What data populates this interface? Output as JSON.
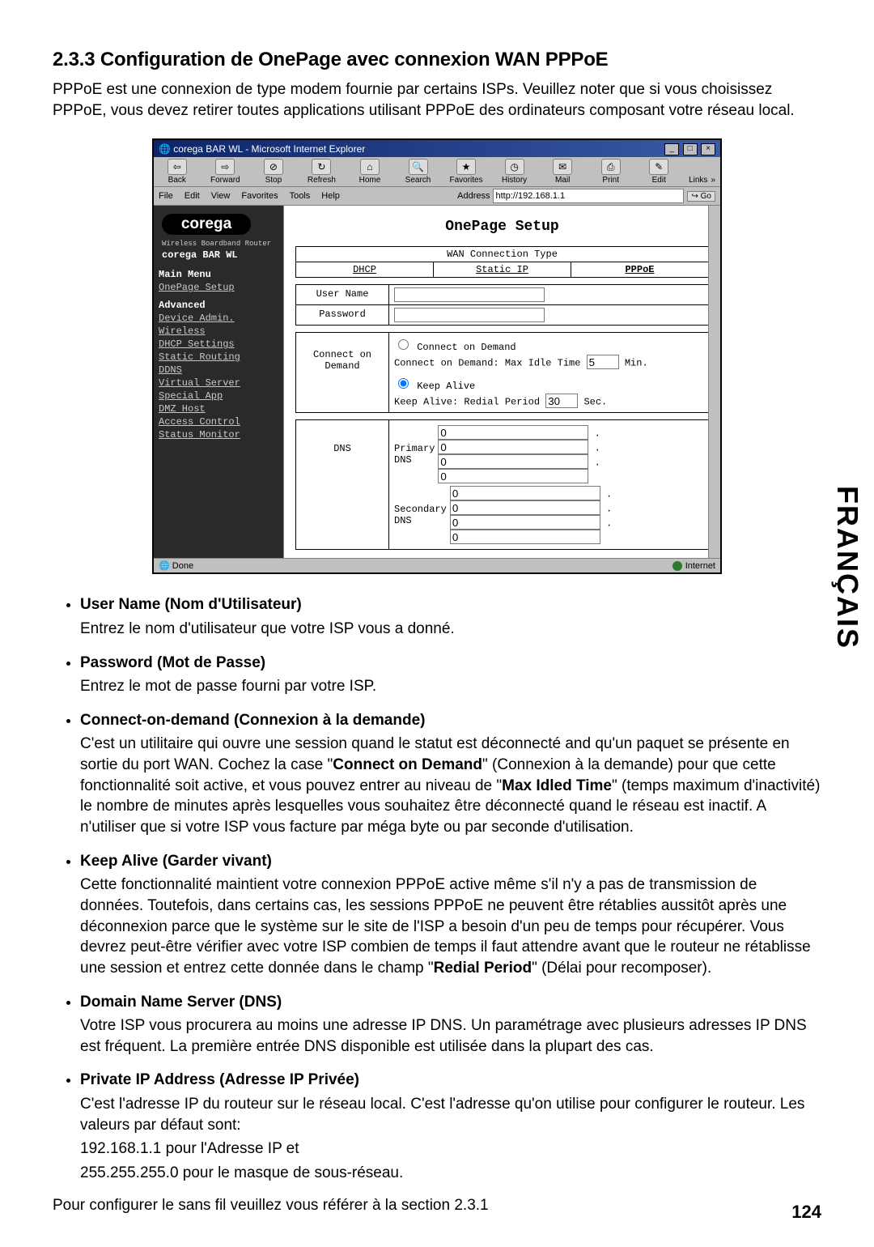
{
  "section_title": "2.3.3 Configuration de OnePage avec connexion WAN PPPoE",
  "intro": "PPPoE  est une connexion de type modem fournie par certains ISPs. Veuillez noter que si vous choisissez PPPoE, vous devez retirer toutes applications utilisant PPPoE des ordinateurs composant votre réseau local.",
  "screenshot": {
    "window_title": "corega BAR WL - Microsoft Internet Explorer",
    "toolbar": {
      "back": "Back",
      "forward": "Forward",
      "stop": "Stop",
      "refresh": "Refresh",
      "home": "Home",
      "search": "Search",
      "favorites": "Favorites",
      "history": "History",
      "mail": "Mail",
      "print": "Print",
      "edit": "Edit"
    },
    "links_label": "Links",
    "menubar": [
      "File",
      "Edit",
      "View",
      "Favorites",
      "Tools",
      "Help"
    ],
    "address_label": "Address",
    "address_value": "http://192.168.1.1",
    "go_label": "Go",
    "sidebar": {
      "logo": "corega",
      "subtitle": "Wireless Boardband Router",
      "product": "corega BAR WL",
      "main_menu_head": "Main Menu",
      "main_menu": [
        "OnePage Setup"
      ],
      "advanced_head": "Advanced",
      "advanced": [
        "Device Admin.",
        "Wireless",
        "DHCP Settings",
        "Static Routing",
        "DDNS",
        "Virtual Server",
        "Special App",
        "DMZ Host",
        "Access Control",
        "Status Monitor"
      ]
    },
    "main": {
      "title": "OnePage Setup",
      "wan_header": "WAN Connection Type",
      "tabs": [
        "DHCP",
        "Static IP",
        "PPPoE"
      ],
      "username_label": "User Name",
      "password_label": "Password",
      "cod_label": "Connect on Demand",
      "cod_radio": "Connect on Demand",
      "cod_line": "Connect on Demand: Max Idle Time",
      "cod_value": "5",
      "cod_unit": "Min.",
      "ka_radio": "Keep Alive",
      "ka_line": "Keep Alive: Redial Period",
      "ka_value": "30",
      "ka_unit": "Sec.",
      "dns_label": "DNS",
      "primary_dns": "Primary DNS",
      "secondary_dns": "Secondary DNS",
      "ip_default": "0"
    },
    "status_done": "Done",
    "status_zone": "Internet"
  },
  "fields": {
    "f1_title": "User Name (Nom d'Utilisateur)",
    "f1_body": "Entrez le nom d'utilisateur que votre ISP vous a donné.",
    "f2_title": "Password (Mot de Passe)",
    "f2_body": "Entrez le mot de passe fourni par votre ISP.",
    "f3_title": "Connect-on-demand (Connexion à la demande)",
    "f3_body_a": "C'est un utilitaire qui ouvre une session quand le statut est déconnecté and qu'un paquet se présente en sortie du port WAN. Cochez la case \"",
    "f3_bold_a": "Connect on Demand",
    "f3_body_b": "\" (Connexion à la demande) pour que cette fonctionnalité soit active, et vous pouvez entrer au niveau de \"",
    "f3_bold_b": "Max Idled Time",
    "f3_body_c": "\" (temps maximum d'inactivité)  le nombre de minutes après lesquelles vous souhaitez être déconnecté quand le réseau est inactif.  A n'utiliser que si votre ISP vous facture par méga byte ou par seconde d'utilisation.",
    "f4_title": "Keep Alive (Garder vivant)",
    "f4_body_a": "Cette fonctionnalité maintient votre connexion PPPoE active même s'il n'y a pas de transmission de données. Toutefois, dans certains cas, les sessions PPPoE ne peuvent être rétablies aussitôt après une déconnexion parce que le système sur le site de l'ISP a besoin d'un peu de temps pour récupérer. Vous devrez peut-être vérifier avec votre ISP combien de temps il faut attendre avant que le routeur ne rétablisse une session et entrez cette donnée dans le champ \"",
    "f4_bold": "Redial Period",
    "f4_body_b": "\" (Délai pour recomposer).",
    "f5_title": "Domain Name Server (DNS)",
    "f5_body": "Votre ISP vous procurera au moins une adresse IP DNS. Un paramétrage avec plusieurs adresses IP DNS est fréquent. La première entrée DNS disponible est utilisée dans la plupart des cas.",
    "f6_title": "Private IP Address (Adresse IP Privée)",
    "f6_body": "C'est l'adresse IP du routeur sur le réseau local. C'est l'adresse qu'on utilise pour configurer le routeur. Les valeurs par défaut sont:",
    "f6_line1": "192.168.1.1 pour l'Adresse IP et",
    "f6_line2": "255.255.255.0  pour le masque de sous-réseau."
  },
  "closing": "Pour configurer le sans fil veuillez vous référer à la section 2.3.1",
  "side_lang": "FRANÇAIS",
  "page_number": "124"
}
